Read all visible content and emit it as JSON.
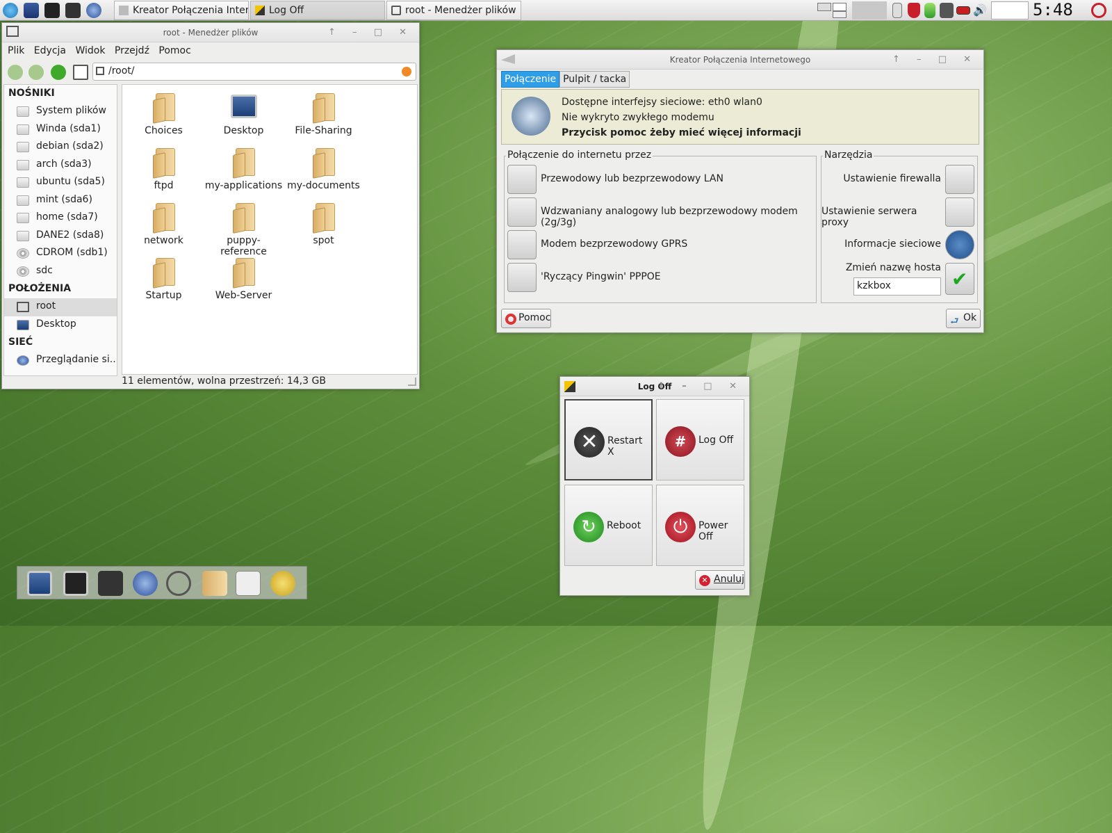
{
  "taskbar": {
    "tasks": [
      {
        "label": "Kreator Połączenia Inter..."
      },
      {
        "label": "Log Off"
      },
      {
        "label": "root - Menedżer plików"
      }
    ],
    "clock": "5:48"
  },
  "file_manager": {
    "title": "root - Menedżer plików",
    "menu": [
      "Plik",
      "Edycja",
      "Widok",
      "Przejdź",
      "Pomoc"
    ],
    "address": "/root/",
    "sidebar": {
      "sections": [
        {
          "heading": "NOŚNIKI",
          "items": [
            "System plików",
            "Winda (sda1)",
            "debian (sda2)",
            "arch (sda3)",
            "ubuntu (sda5)",
            "mint (sda6)",
            "home (sda7)",
            "DANE2 (sda8)",
            "CDROM (sdb1)",
            "sdc"
          ]
        },
        {
          "heading": "POŁOŻENIA",
          "items": [
            "root",
            "Desktop"
          ]
        },
        {
          "heading": "SIEĆ",
          "items": [
            "Przeglądanie si..."
          ]
        }
      ]
    },
    "files": [
      "Choices",
      "Desktop",
      "File-Sharing",
      "ftpd",
      "my-applications",
      "my-documents",
      "network",
      "puppy-reference",
      "spot",
      "Startup",
      "Web-Server"
    ],
    "status": "11 elementów, wolna przestrzeń: 14,3 GB"
  },
  "kreator": {
    "title": "Kreator Połączenia Internetowego",
    "tabs": [
      "Połączenie",
      "Pulpit / tacka"
    ],
    "info": {
      "line1": "Dostępne interfejsy sieciowe: eth0 wlan0",
      "line2": "Nie wykryto zwykłego modemu",
      "line3": "Przycisk pomoc żeby mieć więcej informacji"
    },
    "connect_group": "Połączenie do internetu przez",
    "connections": [
      "Przewodowy lub bezprzewodowy LAN",
      "Wdzwaniany analogowy lub bezprzewodowy modem (2g/3g)",
      "Modem bezprzewodowy GPRS",
      "'Ryczący Pingwin' PPPOE"
    ],
    "tools_group": "Narzędzia",
    "tools": [
      "Ustawienie firewalla",
      "Ustawienie serwera proxy",
      "Informacje sieciowe"
    ],
    "hostname_label": "Zmień nazwę hosta",
    "hostname_value": "kzkbox",
    "help_button": "Pomoc",
    "ok_button": "Ok"
  },
  "logoff": {
    "title": "Log Off",
    "buttons": [
      "Restart X",
      "Log Off",
      "Reboot",
      "Power Off"
    ],
    "cancel": "Anuluj"
  },
  "colors": {
    "tab_active": "#2f9ee8",
    "info_bg": "#ecebd6",
    "danger": "#c81e2a",
    "success": "#3aa83a"
  }
}
